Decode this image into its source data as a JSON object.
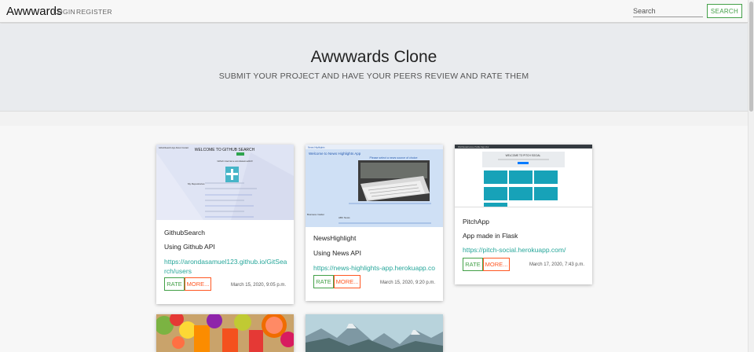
{
  "navbar": {
    "brand": "Awwwards",
    "login": "LOGIN",
    "register": "REGISTER",
    "search_placeholder": "Search",
    "search_button": "SEARCH"
  },
  "hero": {
    "title": "Awwwards Clone",
    "subtitle": "SUBMIT YOUR PROJECT AND HAVE YOUR PEERS REVIEW AND RATE THEM"
  },
  "projects": [
    {
      "title": "GithubSearch",
      "description": "Using Github API",
      "link": "https://arondasamuel123.github.io/GitSearch/users",
      "rate_label": "RATE",
      "more_label": "MORE...",
      "date": "March 15, 2020, 9:05 p.m.",
      "thumb": {
        "heading": "WELCOME TO GITHUB SEARCH",
        "nav": "GithubSearch App   About   Contact",
        "username": "Github Username  arondasamuel123",
        "repos": "My Repositories"
      }
    },
    {
      "title": "NewsHighlight",
      "description": "Using News API",
      "link": "https://news-highlights-app.herokuapp.com/",
      "rate_label": "RATE",
      "more_label": "MORE...",
      "date": "March 15, 2020, 9:20 p.m.",
      "thumb": {
        "nav": "News Highlights",
        "welcome": "Welcome to News Highlights App",
        "prompt": "Please select a news source of choice",
        "source_1": "Business Insider",
        "source_2": "ABC News"
      }
    },
    {
      "title": "PitchApp",
      "description": "App made in Flask",
      "link": "https://pitch-social.herokuapp.com/",
      "rate_label": "RATE",
      "more_label": "MORE...",
      "date": "March 17, 2020, 7:43 p.m.",
      "thumb": {
        "nav": "PitchSocial   Home   Profile   Sign Out",
        "heading": "WELCOME TO PITCH SOCIAL"
      }
    }
  ],
  "colors": {
    "accent_green": "#43a047",
    "link_teal": "#26a69a",
    "more_orange": "#ff5722",
    "pitch_tile": "#17a2b8"
  }
}
